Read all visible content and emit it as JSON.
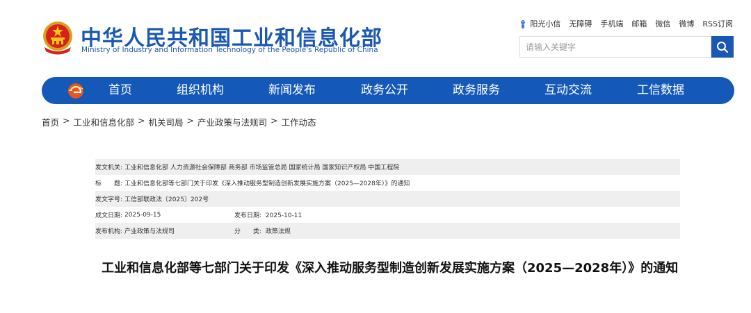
{
  "header": {
    "title_cn": "中华人民共和国工业和信息化部",
    "title_en": "Ministry of Industry and Information Technology of the People's Republic of China",
    "top_links": [
      "阳光小信",
      "无障碍",
      "手机端",
      "邮箱",
      "微信",
      "微博",
      "RSS订阅"
    ],
    "search_placeholder": "请输入关键字"
  },
  "nav": {
    "items": [
      "首页",
      "组织机构",
      "新闻发布",
      "政务公开",
      "政务服务",
      "互动交流",
      "工信数据"
    ]
  },
  "breadcrumb": {
    "items": [
      "首页",
      "工业和信息化部",
      "机关司局",
      "产业政策与法规司",
      "工作动态"
    ],
    "separator": ">"
  },
  "meta": {
    "issuer_label": "发文机关:",
    "issuer_value": "工业和信息化部 人力资源社会保障部 商务部 市场监管总局 国家统计局 国家知识产权局 中国工程院",
    "subject_label": "标　　题:",
    "subject_value": "工业和信息化部等七部门关于印发《深入推动服务型制造创新发展实施方案（2025—2028年）》的通知",
    "docno_label": "发文字号:",
    "docno_value": "工信部联政法〔2025〕202号",
    "created_label": "成文日期:",
    "created_value": "2025-09-15",
    "published_label": "发布日期:",
    "published_value": "2025-10-11",
    "dept_label": "发布机构:",
    "dept_value": "产业政策与法规司",
    "category_label": "分　　类:",
    "category_value": "政策法规"
  },
  "article": {
    "title": "工业和信息化部等七部门关于印发《深入推动服务型制造创新发展实施方案（2025—2028年）》的通知"
  },
  "colors": {
    "brand_blue": "#1559b8",
    "title_blue": "#1a58b3",
    "row_shade": "#efefef"
  }
}
